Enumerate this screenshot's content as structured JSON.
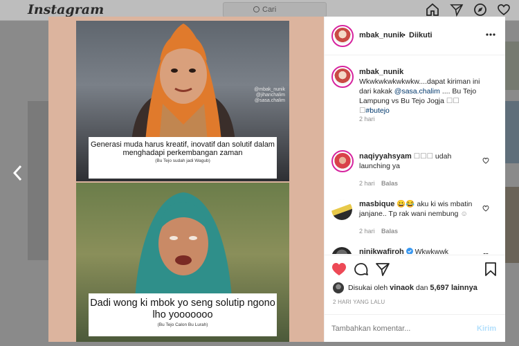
{
  "app": {
    "logo": "Instagram"
  },
  "search": {
    "placeholder": "Cari"
  },
  "post": {
    "author": "mbak_nunik",
    "follow_state": "Diikuti",
    "caption_author": "mbak_nunik",
    "caption_text": "Wkwkwkwkwkwkw....dapat kiriman ini dari kakak",
    "caption_mention": "@sasa.chalim",
    "caption_rest": "....  Bu Tejo Lampung vs Bu Tejo Jogja",
    "caption_tag": "#butejo",
    "caption_time": "2 hari",
    "image": {
      "top_caption": "Generasi muda harus kreatif, inovatif dan solutif dalam menghadapi perkembangan zaman",
      "top_subcaption": "(Bu Tejo sudah jadi Wagub)",
      "bottom_caption": "Dadi wong ki mbok yo seng solutip ngono lho yooooooo",
      "bottom_subcaption": "(Bu Tejo Calon Bu Lurah)",
      "watermark_1": "@mbak_nunik",
      "watermark_2": "@jihanchalim",
      "watermark_3": "@sasa.chalim"
    },
    "comments": [
      {
        "user": "naqiyyahsyam",
        "text": "udah launching ya",
        "time": "2 hari",
        "reply": "Balas"
      },
      {
        "user": "masbique",
        "text": "aku ki wis mbatin janjane.. Tp rak wani nembung",
        "time": "2 hari",
        "reply": "Balas"
      },
      {
        "user": "ninikwafiroh",
        "text": "Wkwkwwk wkwkwkwk",
        "verified": true
      }
    ],
    "liked_by_prefix": "Disukai oleh",
    "liked_by_user": "vinaok",
    "liked_by_and": "dan",
    "likes_count": "5,697 lainnya",
    "timestamp": "2 HARI YANG LALU",
    "comment_placeholder": "Tambahkan komentar...",
    "post_button": "Kirim"
  },
  "colors": {
    "heart": "#ed4956",
    "link": "#00376b",
    "post_button": "#b2dffc",
    "verified": "#3897f0"
  }
}
